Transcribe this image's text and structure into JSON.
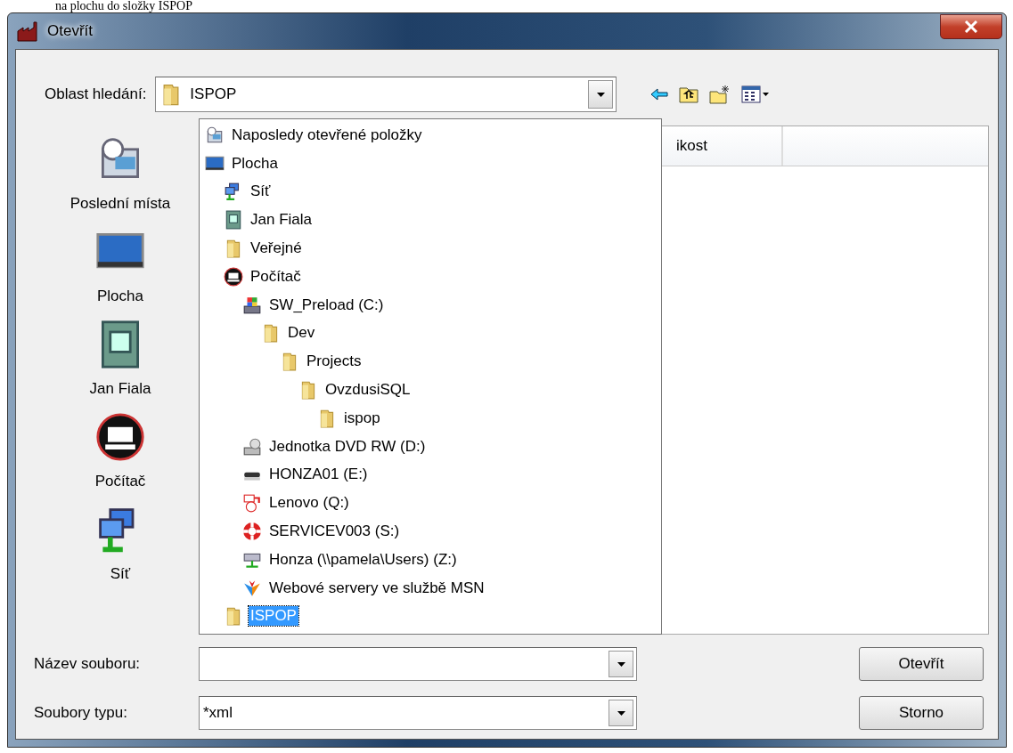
{
  "caption": "na plochu do složky ISPOP",
  "window": {
    "title": "Otevřít"
  },
  "look_in": {
    "label": "Oblast hledání:",
    "value": "ISPOP"
  },
  "places": [
    {
      "label": "Poslední místa",
      "kind": "recent"
    },
    {
      "label": "Plocha",
      "kind": "desktop"
    },
    {
      "label": "Jan Fiala",
      "kind": "user"
    },
    {
      "label": "Počítač",
      "kind": "computer"
    },
    {
      "label": "Síť",
      "kind": "network"
    }
  ],
  "file_list": {
    "columns": [
      "ikost"
    ]
  },
  "folder_tree": [
    {
      "label": "Naposledy otevřené položky",
      "kind": "recent",
      "selected": false
    },
    {
      "label": "Plocha",
      "kind": "desktop",
      "selected": false,
      "children": [
        {
          "label": "Síť",
          "kind": "network",
          "selected": false
        },
        {
          "label": "Jan Fiala",
          "kind": "user",
          "selected": false
        },
        {
          "label": "Veřejné",
          "kind": "folder",
          "selected": false
        },
        {
          "label": "Počítač",
          "kind": "computer",
          "selected": false,
          "children": [
            {
              "label": "SW_Preload (C:)",
              "kind": "drive",
              "selected": false,
              "children": [
                {
                  "label": "Dev",
                  "kind": "folder",
                  "selected": false,
                  "children": [
                    {
                      "label": "Projects",
                      "kind": "folder",
                      "selected": false,
                      "children": [
                        {
                          "label": "OvzdusiSQL",
                          "kind": "folder",
                          "selected": false,
                          "children": [
                            {
                              "label": "ispop",
                              "kind": "folder",
                              "selected": false
                            }
                          ]
                        }
                      ]
                    }
                  ]
                }
              ]
            },
            {
              "label": "Jednotka DVD RW (D:)",
              "kind": "dvd",
              "selected": false
            },
            {
              "label": "HONZA01 (E:)",
              "kind": "removable",
              "selected": false
            },
            {
              "label": "Lenovo (Q:)",
              "kind": "restore",
              "selected": false
            },
            {
              "label": "SERVICEV003 (S:)",
              "kind": "service",
              "selected": false
            },
            {
              "label": "Honza (\\\\pamela\\Users) (Z:)",
              "kind": "netdrive",
              "selected": false
            },
            {
              "label": "Webové servery ve službě MSN",
              "kind": "web",
              "selected": false
            }
          ]
        },
        {
          "label": "ISPOP",
          "kind": "folder",
          "selected": true
        }
      ]
    }
  ],
  "file_name": {
    "label": "Název souboru:"
  },
  "file_type": {
    "label": "Soubory typu:",
    "value": "*xml"
  },
  "buttons": [
    "Otevřít",
    "Storno"
  ]
}
